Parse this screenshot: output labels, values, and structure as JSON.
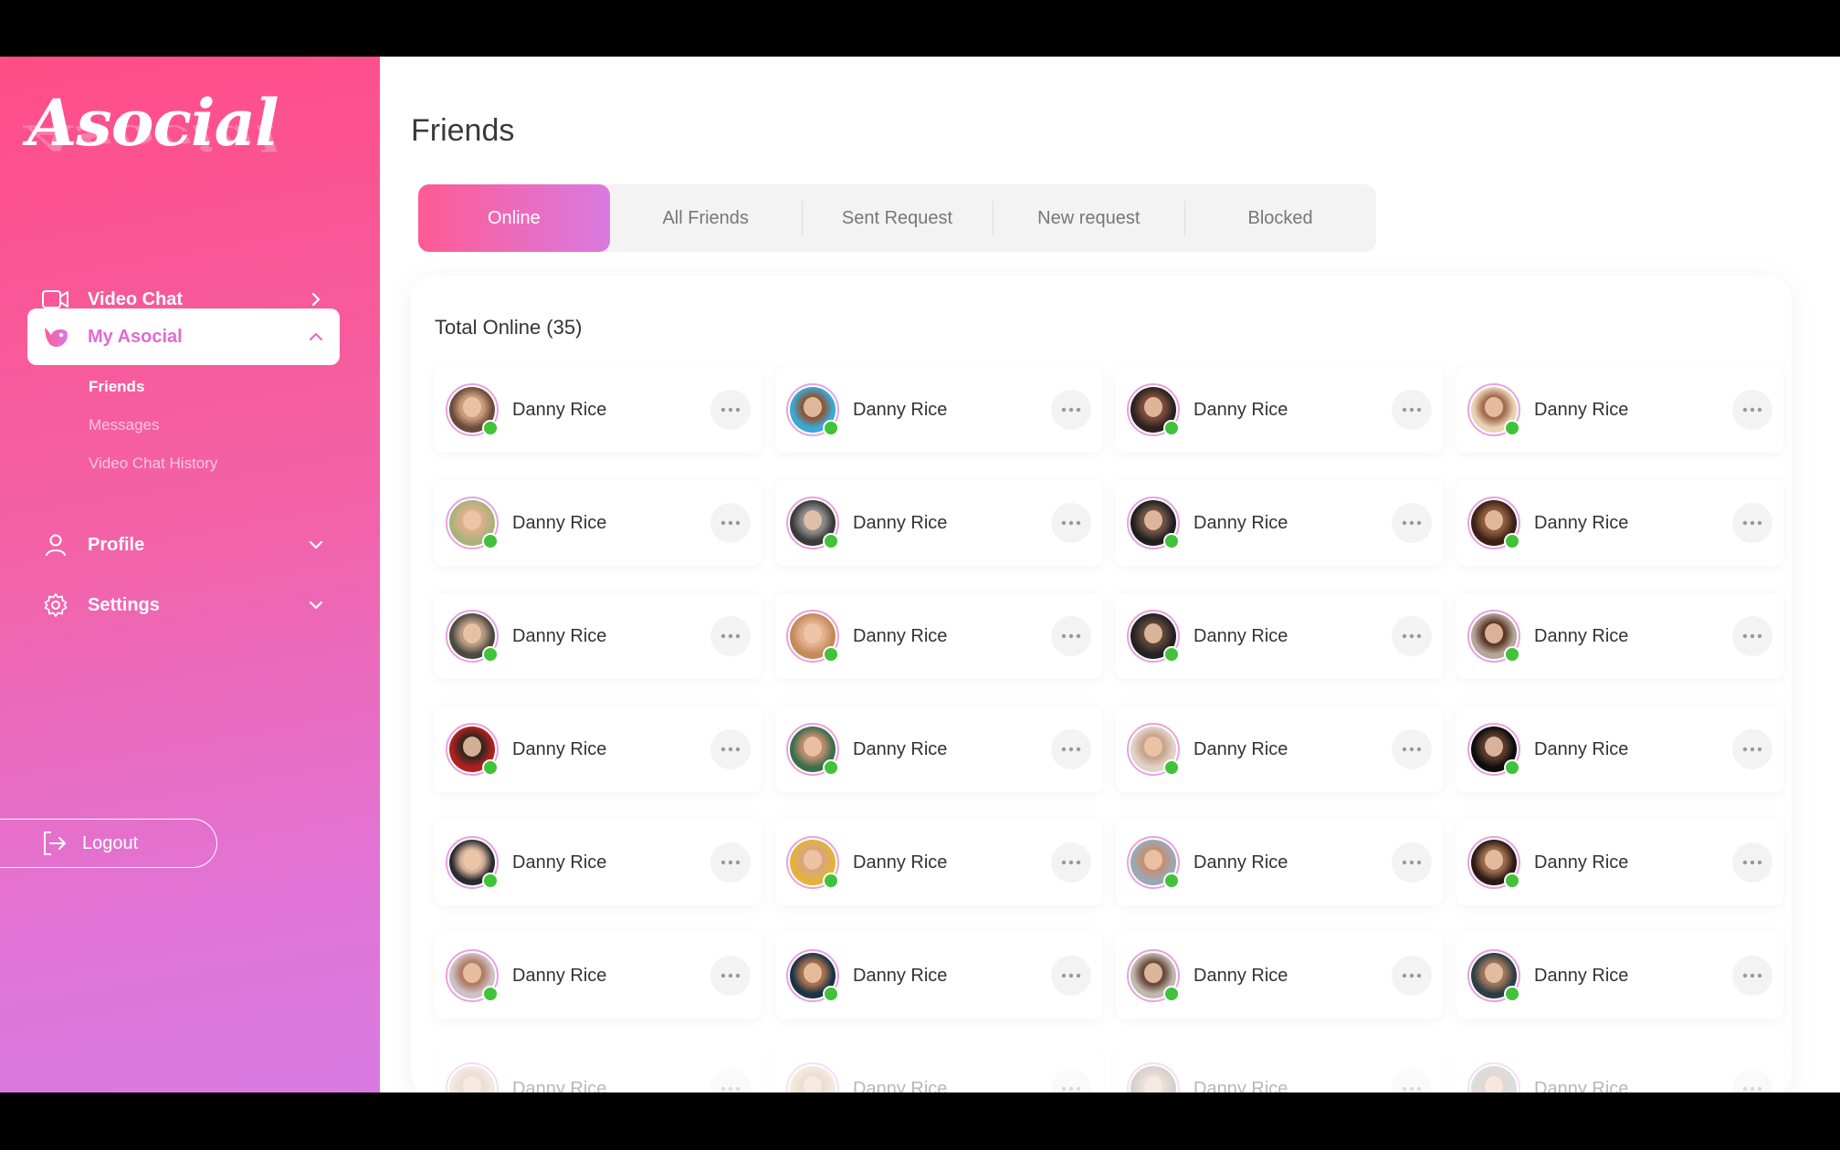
{
  "brand": {
    "logo_text": "Asocial"
  },
  "sidebar": {
    "items": [
      {
        "label": "Video Chat",
        "icon": "video-camera-icon",
        "chevron": "chevron-right-icon"
      },
      {
        "label": "My Asocial",
        "icon": "asocial-logo-icon",
        "chevron": "chevron-up-icon",
        "active": true
      },
      {
        "label": "Profile",
        "icon": "user-icon",
        "chevron": "chevron-down-icon"
      },
      {
        "label": "Settings",
        "icon": "gear-icon",
        "chevron": "chevron-down-icon"
      }
    ],
    "sub_items": [
      {
        "label": "Friends",
        "active": true
      },
      {
        "label": "Messages"
      },
      {
        "label": "Video Chat History"
      }
    ],
    "logout_label": "Logout"
  },
  "main": {
    "title": "Friends",
    "tabs": [
      {
        "label": "Online",
        "active": true
      },
      {
        "label": "All Friends"
      },
      {
        "label": "Sent Request"
      },
      {
        "label": "New request"
      },
      {
        "label": "Blocked"
      }
    ],
    "total_label": "Total Online (35)",
    "friends": [
      {
        "name": "Danny Rice",
        "online": true
      },
      {
        "name": "Danny Rice",
        "online": true
      },
      {
        "name": "Danny Rice",
        "online": true
      },
      {
        "name": "Danny Rice",
        "online": true
      },
      {
        "name": "Danny Rice",
        "online": true
      },
      {
        "name": "Danny Rice",
        "online": true
      },
      {
        "name": "Danny Rice",
        "online": true
      },
      {
        "name": "Danny Rice",
        "online": true
      },
      {
        "name": "Danny Rice",
        "online": true
      },
      {
        "name": "Danny Rice",
        "online": true
      },
      {
        "name": "Danny Rice",
        "online": true
      },
      {
        "name": "Danny Rice",
        "online": true
      },
      {
        "name": "Danny Rice",
        "online": true
      },
      {
        "name": "Danny Rice",
        "online": true
      },
      {
        "name": "Danny Rice",
        "online": true
      },
      {
        "name": "Danny Rice",
        "online": true
      },
      {
        "name": "Danny Rice",
        "online": true
      },
      {
        "name": "Danny Rice",
        "online": true
      },
      {
        "name": "Danny Rice",
        "online": true
      },
      {
        "name": "Danny Rice",
        "online": true
      },
      {
        "name": "Danny Rice",
        "online": true
      },
      {
        "name": "Danny Rice",
        "online": true
      },
      {
        "name": "Danny Rice",
        "online": true
      },
      {
        "name": "Danny Rice",
        "online": true
      },
      {
        "name": "Danny Rice",
        "online": false
      },
      {
        "name": "Danny Rice",
        "online": false
      },
      {
        "name": "Danny Rice",
        "online": false
      },
      {
        "name": "Danny Rice",
        "online": false
      }
    ]
  },
  "colors": {
    "accent_start": "#ff5b94",
    "accent_end": "#d97ae0",
    "online": "#41c23a"
  }
}
